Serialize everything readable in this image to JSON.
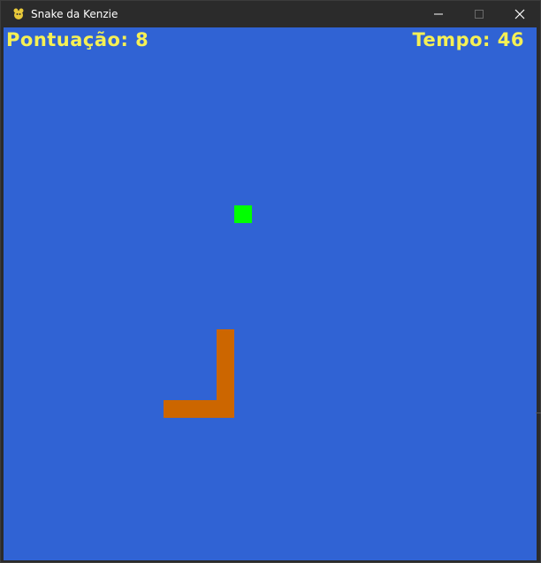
{
  "window": {
    "title": "Snake da Kenzie",
    "app_icon": "pygame-snake-icon",
    "controls": [
      "minimize-icon",
      "maximize-icon",
      "close-icon"
    ]
  },
  "hud": {
    "score_label": "Pontuação: 8",
    "time_label": "Tempo: 46"
  },
  "game": {
    "background_color": "#3063d4",
    "hud_text_color": "#f5f055",
    "food_color": "#00ff00",
    "snake_color": "#cc6600"
  }
}
